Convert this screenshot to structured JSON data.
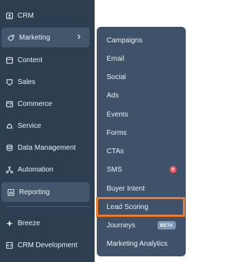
{
  "sidebar": {
    "items": [
      {
        "label": "CRM",
        "icon": "crm-icon"
      },
      {
        "label": "Marketing",
        "icon": "marketing-icon"
      },
      {
        "label": "Content",
        "icon": "content-icon"
      },
      {
        "label": "Sales",
        "icon": "sales-icon"
      },
      {
        "label": "Commerce",
        "icon": "commerce-icon"
      },
      {
        "label": "Service",
        "icon": "service-icon"
      },
      {
        "label": "Data Management",
        "icon": "data-management-icon"
      },
      {
        "label": "Automation",
        "icon": "automation-icon"
      },
      {
        "label": "Reporting",
        "icon": "reporting-icon"
      },
      {
        "label": "Breeze",
        "icon": "breeze-icon"
      },
      {
        "label": "CRM Development",
        "icon": "crm-development-icon"
      }
    ]
  },
  "flyout": {
    "items": [
      {
        "label": "Campaigns"
      },
      {
        "label": "Email"
      },
      {
        "label": "Social"
      },
      {
        "label": "Ads"
      },
      {
        "label": "Events"
      },
      {
        "label": "Forms"
      },
      {
        "label": "CTAs"
      },
      {
        "label": "SMS",
        "badge_icon": "arrow-up-icon"
      },
      {
        "label": "Buyer Intent"
      },
      {
        "label": "Lead Scoring"
      },
      {
        "label": "Journeys",
        "badge": "BETA"
      },
      {
        "label": "Marketing Analytics"
      }
    ]
  },
  "colors": {
    "sidebar_bg": "#2d3e50",
    "flyout_bg": "#3f5269",
    "highlight_border": "#f07a2b",
    "alert_badge": "#f2545b",
    "beta_badge": "#7c98b6"
  }
}
